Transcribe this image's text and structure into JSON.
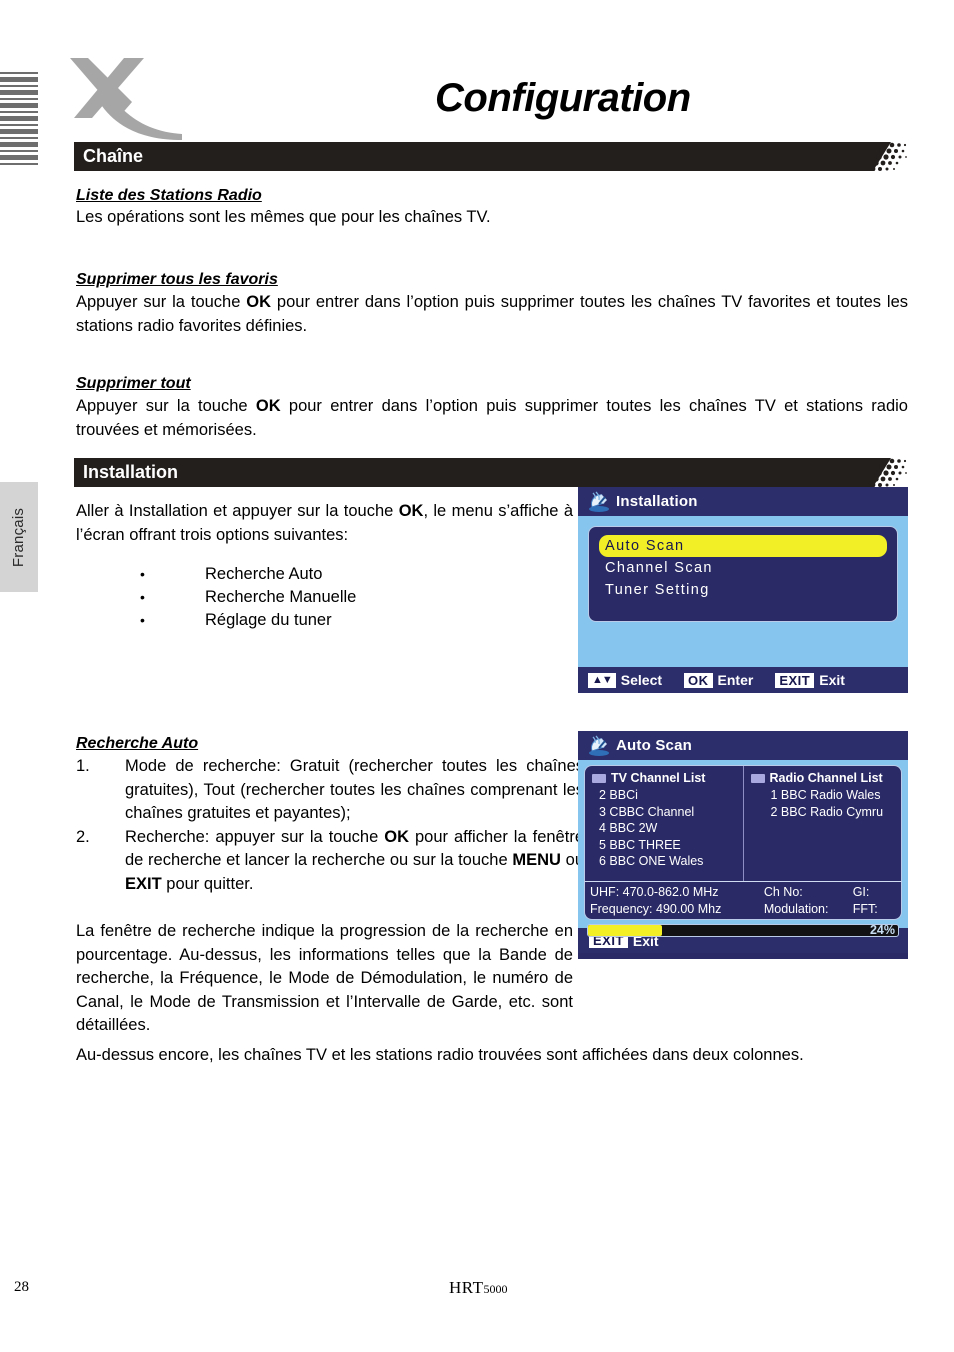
{
  "page": {
    "title": "Configuration",
    "language_tab": "Français",
    "page_number": "28",
    "model_prefix": "HRT",
    "model_suffix": "5000"
  },
  "sections": [
    {
      "bar_label": "Chaîne",
      "blocks": [
        {
          "heading": "Liste des Stations Radio",
          "body": "Les opérations sont les mêmes que pour les chaînes TV."
        },
        {
          "heading": "Supprimer tous les favoris",
          "body_pre": "Appuyer sur la touche ",
          "body_key": "OK",
          "body_post": " pour entrer dans l’option puis supprimer toutes les chaînes TV favorites et toutes les stations radio favorites définies."
        },
        {
          "heading": "Supprimer tout",
          "body_pre": "Appuyer sur la touche ",
          "body_key": "OK",
          "body_post": " pour entrer dans l’option puis supprimer toutes les chaînes TV et stations radio trouvées et mémorisées."
        }
      ]
    },
    {
      "bar_label": "Installation",
      "intro_pre": "Aller à Installation et appuyer sur la touche ",
      "intro_key": "OK",
      "intro_post": ", le menu s’affiche à l’écran offrant trois options suivantes:",
      "options": [
        "Recherche Auto",
        "Recherche Manuelle",
        "Réglage du tuner"
      ],
      "auto_heading": "Recherche Auto",
      "steps": [
        {
          "num": "1.",
          "text": "Mode de recherche: Gratuit (rechercher toutes les chaînes gratuites), Tout (rechercher toutes les chaînes comprenant les chaînes gratuites et payantes);"
        },
        {
          "num": "2.",
          "pre": "Recherche: appuyer sur la touche ",
          "key1": "OK",
          "mid": " pour afficher la fenêtre de recherche et lancer la recherche ou sur la touche ",
          "key2": "MENU",
          "mid2": " ou ",
          "key3": "EXIT",
          "post": " pour quitter."
        }
      ],
      "para_wrap": "La fenêtre de recherche indique la progression de la recherche en pourcentage. Au-dessus, les informations telles que la Bande de recherche, la Fréquence, le Mode de Démodulation, le numéro de Canal, le Mode de Transmission et l’Intervalle de Garde, etc. sont détaillées.",
      "para_last": "Au-dessus encore, les chaînes TV et les stations radio trouvées sont affichées dans deux colonnes."
    }
  ],
  "osd_installation": {
    "icon": "satellite-dish-icon",
    "title": "Installation",
    "menu": [
      {
        "label": "Auto Scan",
        "selected": true
      },
      {
        "label": "Channel Scan",
        "selected": false
      },
      {
        "label": "Tuner Setting",
        "selected": false
      }
    ],
    "footer": [
      {
        "key": "▲▼",
        "label": "Select"
      },
      {
        "key": "OK",
        "label": "Enter"
      },
      {
        "key": "EXIT",
        "label": "Exit"
      }
    ]
  },
  "osd_autoscan": {
    "icon": "satellite-dish-icon",
    "title": "Auto Scan",
    "tv_list_header": "TV Channel List",
    "tv_channels": [
      "2 BBCi",
      "3 CBBC Channel",
      "4 BBC 2W",
      "5 BBC THREE",
      "6 BBC ONE Wales"
    ],
    "radio_list_header": "Radio Channel List",
    "radio_channels": [
      "1 BBC Radio Wales",
      "2 BBC Radio Cymru"
    ],
    "info": {
      "uhf_label": "UHF: 470.0-862.0 MHz",
      "chno_label": "Ch No:",
      "gi_label": "GI:",
      "freq_label": "Frequency: 490.00 Mhz",
      "mod_label": "Modulation:",
      "fft_label": "FFT:"
    },
    "progress_percent": "24%",
    "progress_value": 24,
    "footer": [
      {
        "key": "EXIT",
        "label": "Exit"
      }
    ]
  },
  "colors": {
    "bar_black": "#231f1d",
    "osd_header": "#2c2d6b",
    "osd_panel": "#2a2a66",
    "osd_backdrop": "#86c5ee",
    "highlight_yellow": "#f2ef26",
    "lang_tab_gray": "#d4d4d4"
  }
}
